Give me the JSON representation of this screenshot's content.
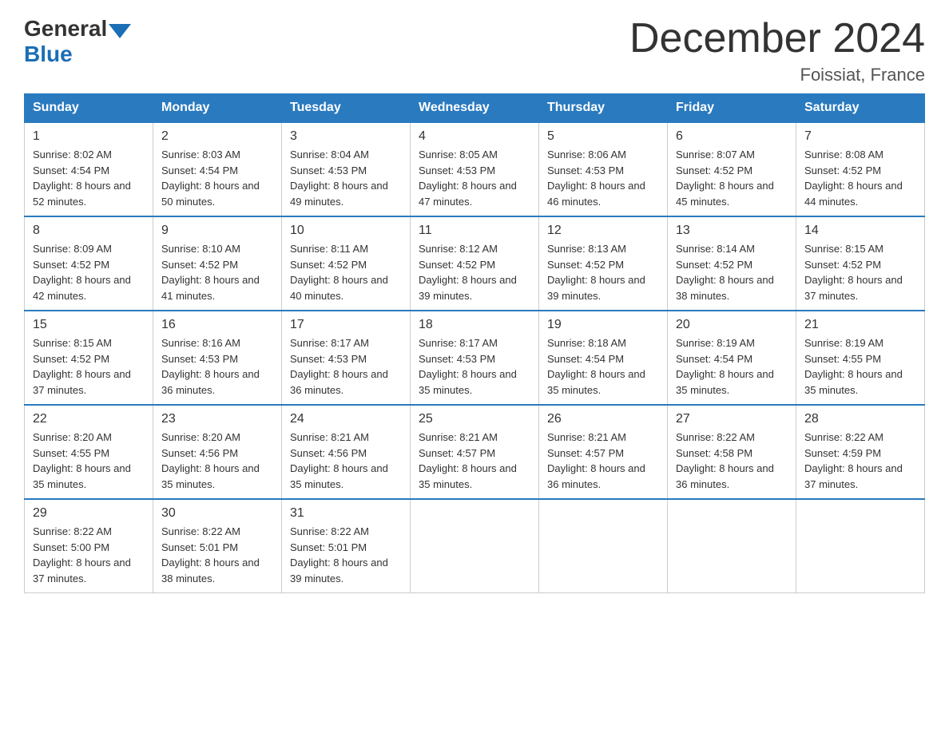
{
  "logo": {
    "general": "General",
    "blue": "Blue"
  },
  "header": {
    "title": "December 2024",
    "location": "Foissiat, France"
  },
  "days_of_week": [
    "Sunday",
    "Monday",
    "Tuesday",
    "Wednesday",
    "Thursday",
    "Friday",
    "Saturday"
  ],
  "weeks": [
    [
      {
        "day": "1",
        "sunrise": "8:02 AM",
        "sunset": "4:54 PM",
        "daylight": "8 hours and 52 minutes."
      },
      {
        "day": "2",
        "sunrise": "8:03 AM",
        "sunset": "4:54 PM",
        "daylight": "8 hours and 50 minutes."
      },
      {
        "day": "3",
        "sunrise": "8:04 AM",
        "sunset": "4:53 PM",
        "daylight": "8 hours and 49 minutes."
      },
      {
        "day": "4",
        "sunrise": "8:05 AM",
        "sunset": "4:53 PM",
        "daylight": "8 hours and 47 minutes."
      },
      {
        "day": "5",
        "sunrise": "8:06 AM",
        "sunset": "4:53 PM",
        "daylight": "8 hours and 46 minutes."
      },
      {
        "day": "6",
        "sunrise": "8:07 AM",
        "sunset": "4:52 PM",
        "daylight": "8 hours and 45 minutes."
      },
      {
        "day": "7",
        "sunrise": "8:08 AM",
        "sunset": "4:52 PM",
        "daylight": "8 hours and 44 minutes."
      }
    ],
    [
      {
        "day": "8",
        "sunrise": "8:09 AM",
        "sunset": "4:52 PM",
        "daylight": "8 hours and 42 minutes."
      },
      {
        "day": "9",
        "sunrise": "8:10 AM",
        "sunset": "4:52 PM",
        "daylight": "8 hours and 41 minutes."
      },
      {
        "day": "10",
        "sunrise": "8:11 AM",
        "sunset": "4:52 PM",
        "daylight": "8 hours and 40 minutes."
      },
      {
        "day": "11",
        "sunrise": "8:12 AM",
        "sunset": "4:52 PM",
        "daylight": "8 hours and 39 minutes."
      },
      {
        "day": "12",
        "sunrise": "8:13 AM",
        "sunset": "4:52 PM",
        "daylight": "8 hours and 39 minutes."
      },
      {
        "day": "13",
        "sunrise": "8:14 AM",
        "sunset": "4:52 PM",
        "daylight": "8 hours and 38 minutes."
      },
      {
        "day": "14",
        "sunrise": "8:15 AM",
        "sunset": "4:52 PM",
        "daylight": "8 hours and 37 minutes."
      }
    ],
    [
      {
        "day": "15",
        "sunrise": "8:15 AM",
        "sunset": "4:52 PM",
        "daylight": "8 hours and 37 minutes."
      },
      {
        "day": "16",
        "sunrise": "8:16 AM",
        "sunset": "4:53 PM",
        "daylight": "8 hours and 36 minutes."
      },
      {
        "day": "17",
        "sunrise": "8:17 AM",
        "sunset": "4:53 PM",
        "daylight": "8 hours and 36 minutes."
      },
      {
        "day": "18",
        "sunrise": "8:17 AM",
        "sunset": "4:53 PM",
        "daylight": "8 hours and 35 minutes."
      },
      {
        "day": "19",
        "sunrise": "8:18 AM",
        "sunset": "4:54 PM",
        "daylight": "8 hours and 35 minutes."
      },
      {
        "day": "20",
        "sunrise": "8:19 AM",
        "sunset": "4:54 PM",
        "daylight": "8 hours and 35 minutes."
      },
      {
        "day": "21",
        "sunrise": "8:19 AM",
        "sunset": "4:55 PM",
        "daylight": "8 hours and 35 minutes."
      }
    ],
    [
      {
        "day": "22",
        "sunrise": "8:20 AM",
        "sunset": "4:55 PM",
        "daylight": "8 hours and 35 minutes."
      },
      {
        "day": "23",
        "sunrise": "8:20 AM",
        "sunset": "4:56 PM",
        "daylight": "8 hours and 35 minutes."
      },
      {
        "day": "24",
        "sunrise": "8:21 AM",
        "sunset": "4:56 PM",
        "daylight": "8 hours and 35 minutes."
      },
      {
        "day": "25",
        "sunrise": "8:21 AM",
        "sunset": "4:57 PM",
        "daylight": "8 hours and 35 minutes."
      },
      {
        "day": "26",
        "sunrise": "8:21 AM",
        "sunset": "4:57 PM",
        "daylight": "8 hours and 36 minutes."
      },
      {
        "day": "27",
        "sunrise": "8:22 AM",
        "sunset": "4:58 PM",
        "daylight": "8 hours and 36 minutes."
      },
      {
        "day": "28",
        "sunrise": "8:22 AM",
        "sunset": "4:59 PM",
        "daylight": "8 hours and 37 minutes."
      }
    ],
    [
      {
        "day": "29",
        "sunrise": "8:22 AM",
        "sunset": "5:00 PM",
        "daylight": "8 hours and 37 minutes."
      },
      {
        "day": "30",
        "sunrise": "8:22 AM",
        "sunset": "5:01 PM",
        "daylight": "8 hours and 38 minutes."
      },
      {
        "day": "31",
        "sunrise": "8:22 AM",
        "sunset": "5:01 PM",
        "daylight": "8 hours and 39 minutes."
      },
      null,
      null,
      null,
      null
    ]
  ],
  "labels": {
    "sunrise": "Sunrise:",
    "sunset": "Sunset:",
    "daylight": "Daylight:"
  }
}
